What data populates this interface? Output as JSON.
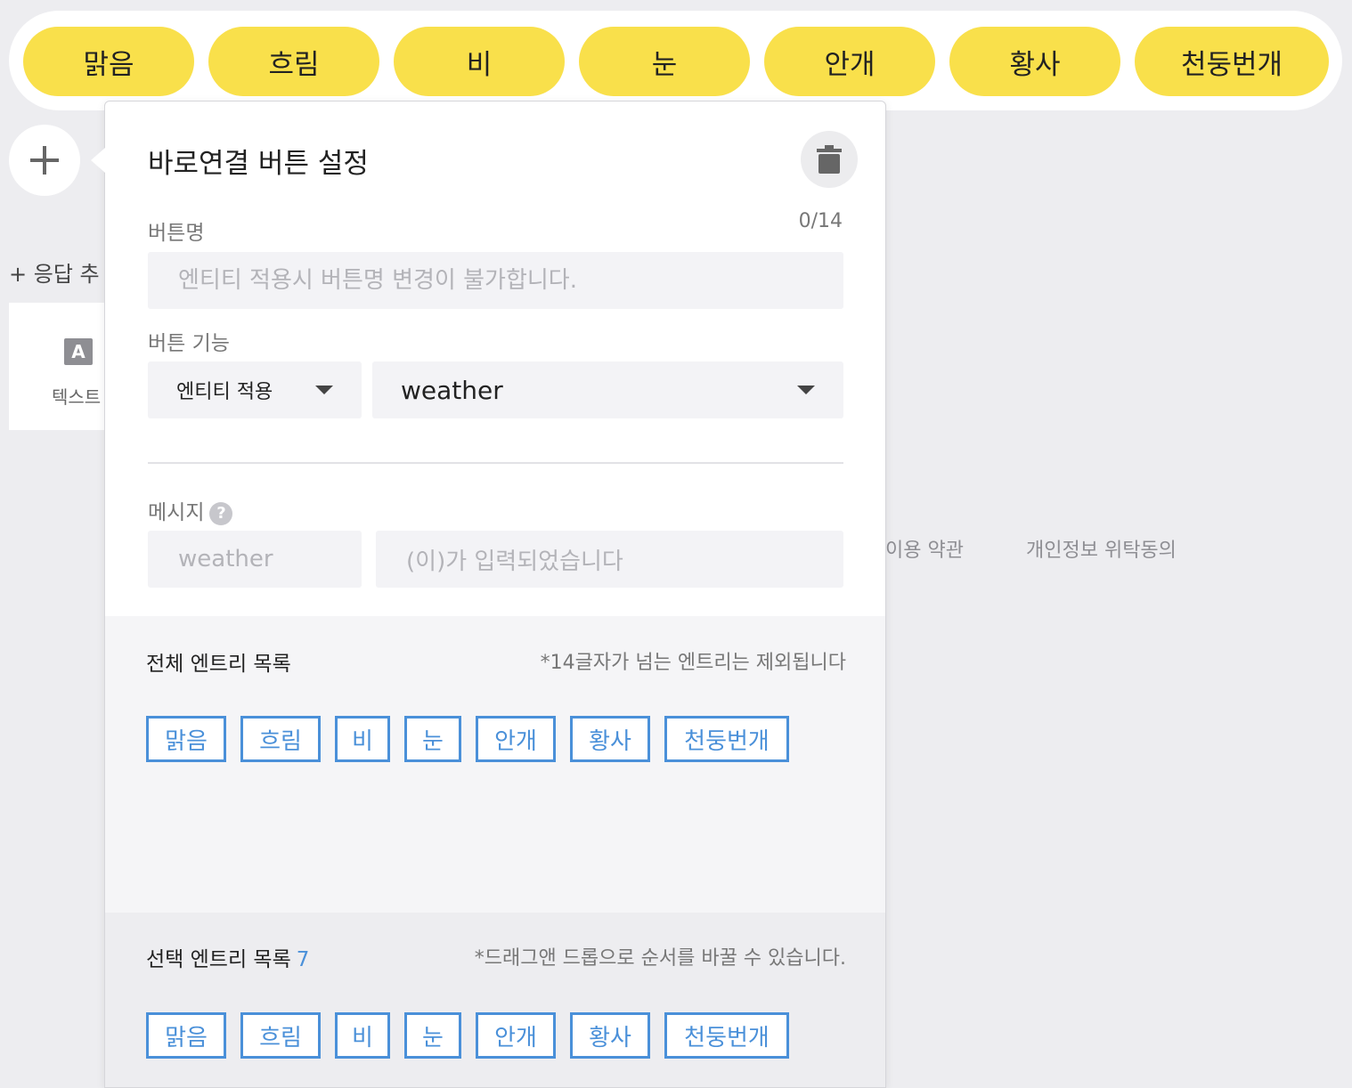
{
  "quick_replies": [
    "맑음",
    "흐림",
    "비",
    "눈",
    "안개",
    "황사",
    "천둥번개"
  ],
  "background": {
    "add_response_label": "+ 응답 추",
    "text_card_icon_letter": "A",
    "text_card_label": "텍스트",
    "footer_links": [
      "이용 약관",
      "개인정보 위탁동의"
    ]
  },
  "popover": {
    "title": "바로연결 버튼 설정",
    "button_name_label": "버튼명",
    "button_name_counter": "0/14",
    "button_name_placeholder": "엔티티 적용시 버튼명 변경이 불가합니다.",
    "button_function_label": "버튼 기능",
    "function_type_value": "엔티티 적용",
    "entity_value": "weather",
    "message_label": "메시지",
    "message_entity": "weather",
    "message_suffix": "(이)가 입력되었습니다",
    "all_entries": {
      "title": "전체 엔트리 목록",
      "note": "*14글자가 넘는 엔트리는 제외됩니다",
      "items": [
        "맑음",
        "흐림",
        "비",
        "눈",
        "안개",
        "황사",
        "천둥번개"
      ]
    },
    "selected_entries": {
      "title": "선택 엔트리 목록",
      "count": "7",
      "note": "*드래그앤 드롭으로 순서를 바꿀 수 있습니다.",
      "items": [
        "맑음",
        "흐림",
        "비",
        "눈",
        "안개",
        "황사",
        "천둥번개"
      ]
    }
  },
  "colors": {
    "chip_yellow": "#f9e04b",
    "tag_blue": "#4a90d9"
  }
}
